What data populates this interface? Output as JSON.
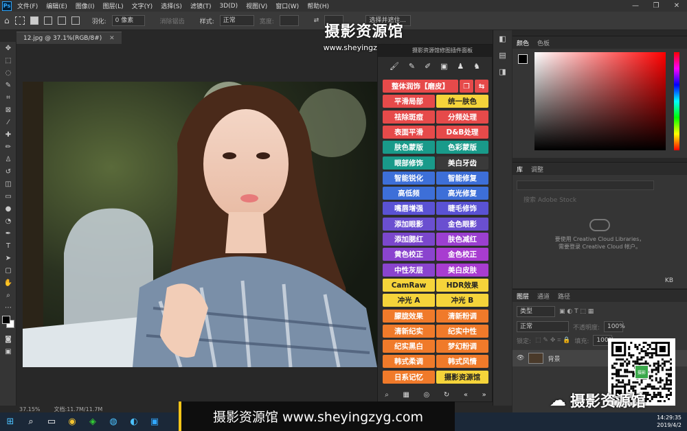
{
  "menubar": {
    "app_icon": "Ps",
    "items": [
      "文件(F)",
      "编辑(E)",
      "图像(I)",
      "图层(L)",
      "文字(Y)",
      "选择(S)",
      "滤镜(T)",
      "3D(D)",
      "视图(V)",
      "窗口(W)",
      "帮助(H)"
    ],
    "min": "—",
    "max": "❐",
    "close": "✕"
  },
  "options": {
    "feather_label": "羽化:",
    "feather_value": "0 像素",
    "antialias": "消除锯齿",
    "style_label": "样式:",
    "style_value": "正常",
    "width_label": "宽度:",
    "mask_btn": "选择并遮住..."
  },
  "document": {
    "tab": "12.jpg @ 37.1%(RGB/8#)",
    "close": "✕",
    "zoom": "37.15%",
    "docsize": "文档:11.7M/11.7M"
  },
  "plugin": {
    "header": "摄影资源馆修图插件面板",
    "icons": [
      "brush-icon",
      "pen-icon",
      "pencil-icon",
      "frame-icon",
      "person-icon",
      "person-add-icon"
    ],
    "rows": [
      {
        "left": {
          "label": "整体润饰【磨皮】",
          "color": "#e64a4a",
          "text": "#fff"
        },
        "extra": [
          "❐",
          "⇆"
        ]
      },
      {
        "left": {
          "label": "平滑局部",
          "color": "#e64a4a"
        },
        "right": {
          "label": "统一肤色",
          "color": "#f5d43a",
          "text": "#222"
        }
      },
      {
        "left": {
          "label": "祛除斑痘",
          "color": "#e64a4a"
        },
        "right": {
          "label": "分频处理",
          "color": "#e64a4a"
        }
      },
      {
        "left": {
          "label": "表面平滑",
          "color": "#e64a4a"
        },
        "right": {
          "label": "D&B处理",
          "color": "#e64a4a"
        }
      },
      {
        "left": {
          "label": "肤色蒙版",
          "color": "#199a8a"
        },
        "right": {
          "label": "色彩蒙版",
          "color": "#199a8a"
        }
      },
      {
        "left": {
          "label": "眼部修饰",
          "color": "#199a8a"
        },
        "right": {
          "label": "美白牙齿",
          "color": "#3a3a3a"
        }
      },
      {
        "left": {
          "label": "智能锐化",
          "color": "#3d6fd8"
        },
        "right": {
          "label": "智能修复",
          "color": "#3d6fd8"
        }
      },
      {
        "left": {
          "label": "高低频",
          "color": "#3d6fd8"
        },
        "right": {
          "label": "高光修复",
          "color": "#3d6fd8"
        }
      },
      {
        "left": {
          "label": "嘴唇增强",
          "color": "#5a52d4"
        },
        "right": {
          "label": "睫毛修饰",
          "color": "#5a52d4"
        }
      },
      {
        "left": {
          "label": "添加眼影",
          "color": "#6a4fd0"
        },
        "right": {
          "label": "金色眼影",
          "color": "#6a4fd0"
        }
      },
      {
        "left": {
          "label": "添加腮红",
          "color": "#7b47cc"
        },
        "right": {
          "label": "肤色减红",
          "color": "#9b3fd0"
        }
      },
      {
        "left": {
          "label": "黄色校正",
          "color": "#8a44ce"
        },
        "right": {
          "label": "金色校正",
          "color": "#a83cd0"
        }
      },
      {
        "left": {
          "label": "中性灰层",
          "color": "#8a44ce"
        },
        "right": {
          "label": "美白皮肤",
          "color": "#a83cd0"
        }
      },
      {
        "left": {
          "label": "CamRaw",
          "color": "#f5d43a",
          "text": "#222"
        },
        "right": {
          "label": "HDR效果",
          "color": "#f5d43a",
          "text": "#222"
        }
      },
      {
        "left": {
          "label": "冲光 A",
          "color": "#f5d43a",
          "text": "#222"
        },
        "right": {
          "label": "冲光 B",
          "color": "#f5d43a",
          "text": "#222"
        }
      },
      {
        "left": {
          "label": "朦胧效果",
          "color": "#f07a2a"
        },
        "right": {
          "label": "清新粉调",
          "color": "#f07a2a"
        }
      },
      {
        "left": {
          "label": "清新纪实",
          "color": "#f07a2a"
        },
        "right": {
          "label": "纪实中性",
          "color": "#f07a2a"
        }
      },
      {
        "left": {
          "label": "纪实黑白",
          "color": "#f07a2a"
        },
        "right": {
          "label": "梦幻粉调",
          "color": "#f07a2a"
        }
      },
      {
        "left": {
          "label": "韩式柔调",
          "color": "#f07a2a"
        },
        "right": {
          "label": "韩式风情",
          "color": "#f07a2a"
        }
      },
      {
        "left": {
          "label": "日系记忆",
          "color": "#f07a2a"
        },
        "right": {
          "label": "摄影资源馆",
          "color": "#f5d43a",
          "text": "#222"
        }
      }
    ],
    "footer": [
      "search-icon",
      "grid-icon",
      "target-icon",
      "refresh-icon",
      "«",
      "»"
    ]
  },
  "panels": {
    "color": {
      "tabs": [
        "颜色",
        "色板"
      ]
    },
    "library": {
      "tabs": [
        "库",
        "调整"
      ],
      "placeholder": "搜索 Adobe Stock",
      "msg1": "要使用 Creative Cloud Libraries，",
      "msg2": "需要登录 Creative Cloud 帐户。",
      "kb": "KB"
    },
    "layers": {
      "tabs": [
        "图层",
        "通道",
        "路径"
      ],
      "kind": "类型",
      "blend": "正常",
      "opacity_label": "不透明度:",
      "opacity": "100%",
      "lock_label": "锁定:",
      "fill_label": "填充:",
      "fill": "100%",
      "layer_name": "背景"
    }
  },
  "watermark": {
    "title": "摄影资源馆",
    "url": "www.sheyingzyg.com"
  },
  "subtitle": "摄影资源馆 www.sheyingzyg.com",
  "wechat": "摄影资源馆",
  "qr_label": "摄影",
  "clock": {
    "time": "14:29:35",
    "date": "2019/4/2"
  }
}
